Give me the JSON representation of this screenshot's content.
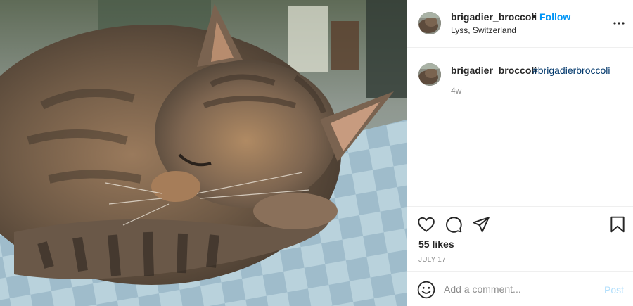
{
  "post": {
    "username": "brigadier_broccoli",
    "separator": "•",
    "follow_label": "Follow",
    "location": "Lyss, Switzerland",
    "caption_hashtag": "#brigadierbroccoli",
    "age": "4w",
    "likes": "55 likes",
    "date": "JULY 17"
  },
  "comment_box": {
    "placeholder": "Add a comment...",
    "post_label": "Post"
  },
  "colors": {
    "follow": "#0095f6",
    "hashtag": "#00376b",
    "post_disabled": "#b2dffc",
    "muted": "#8e8e8e"
  },
  "icons": [
    "heart-icon",
    "comment-bubble-icon",
    "send-icon",
    "bookmark-icon",
    "more-options-icon",
    "emoji-icon"
  ]
}
